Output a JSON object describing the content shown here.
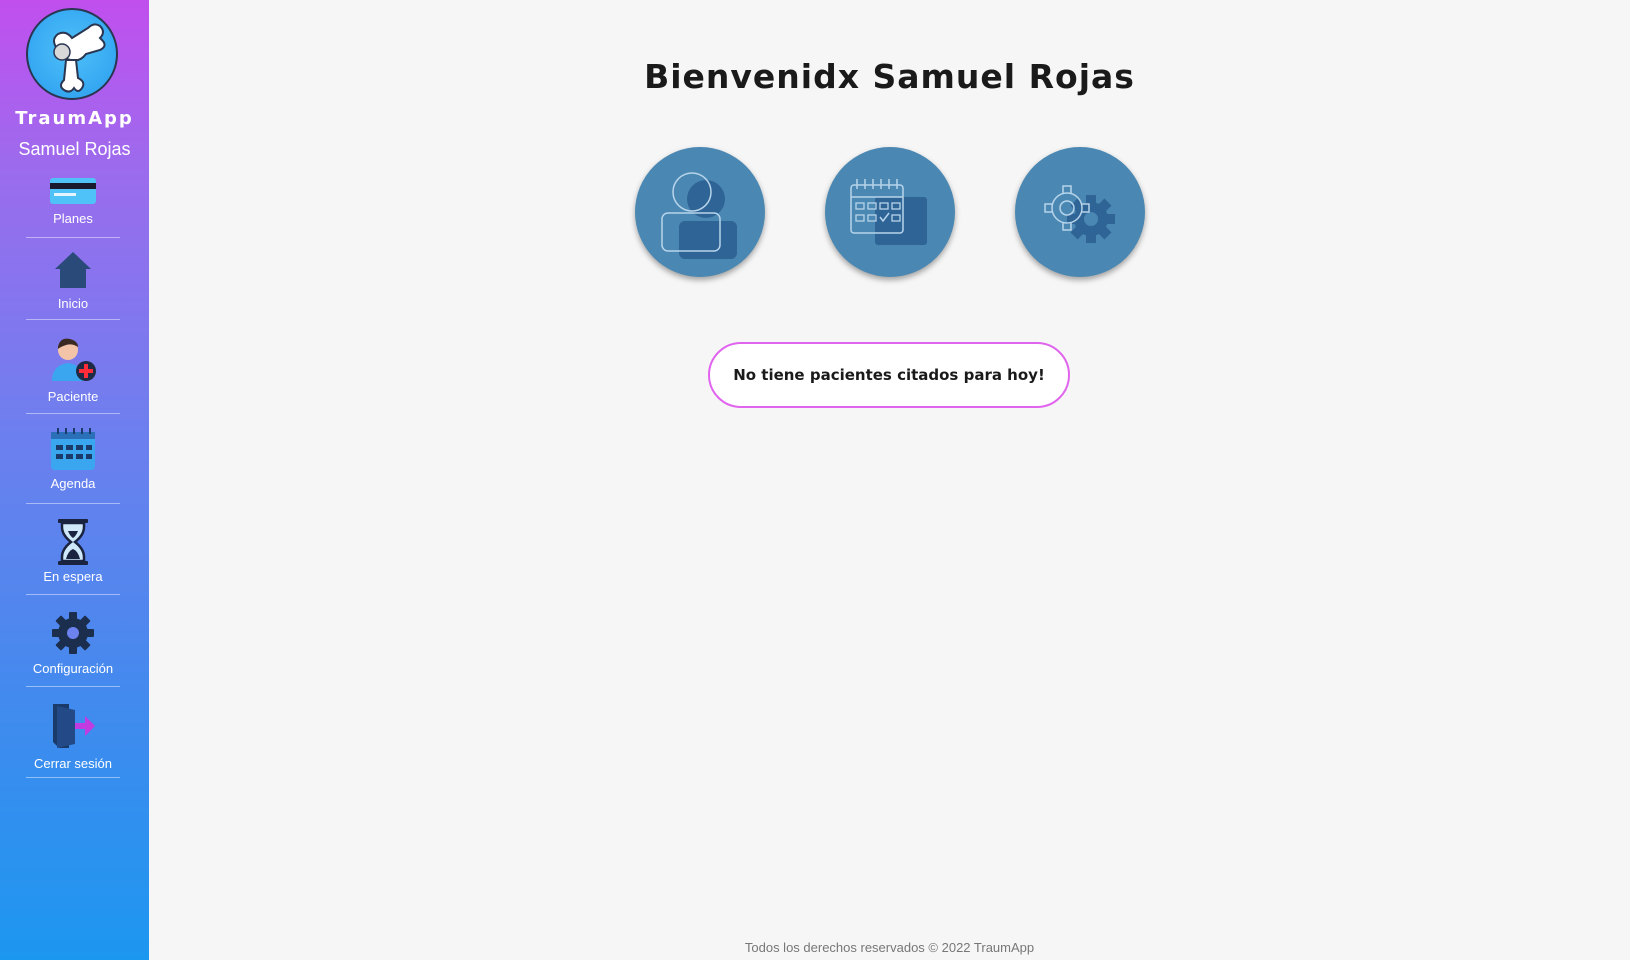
{
  "app": {
    "brand": "TraumApp",
    "user_name": "Samuel Rojas"
  },
  "sidebar": {
    "items": [
      {
        "label": "Planes",
        "icon": "credit-card-icon"
      },
      {
        "label": "Inicio",
        "icon": "home-icon"
      },
      {
        "label": "Paciente",
        "icon": "add-patient-icon"
      },
      {
        "label": "Agenda",
        "icon": "calendar-icon"
      },
      {
        "label": "En espera",
        "icon": "hourglass-icon"
      },
      {
        "label": "Configuración",
        "icon": "gear-icon"
      },
      {
        "label": "Cerrar sesión",
        "icon": "logout-door-icon"
      }
    ]
  },
  "main": {
    "title": "Bienvenidx Samuel Rojas",
    "quick_actions": [
      {
        "icon": "user-profile-icon"
      },
      {
        "icon": "calendar-icon"
      },
      {
        "icon": "gears-icon"
      }
    ],
    "notice": "No tiene pacientes citados para hoy!"
  },
  "footer": {
    "text": "Todos los derechos reservados © 2022 TraumApp"
  },
  "colors": {
    "sidebar_top": "#c14fee",
    "sidebar_bottom": "#1c97f0",
    "circle_button": "#4a88b3",
    "notice_border": "#e064ee"
  }
}
